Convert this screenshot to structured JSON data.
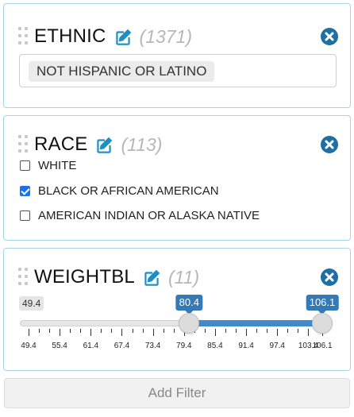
{
  "filters": [
    {
      "title": "ETHNIC",
      "count": "(1371)",
      "selected_values": [
        "NOT HISPANIC OR LATINO"
      ]
    },
    {
      "title": "RACE",
      "count": "(113)",
      "options": [
        {
          "label": "WHITE",
          "checked": false
        },
        {
          "label": "BLACK OR AFRICAN AMERICAN",
          "checked": true
        },
        {
          "label": "AMERICAN INDIAN OR ALASKA NATIVE",
          "checked": false
        }
      ]
    },
    {
      "title": "WEIGHTBL",
      "count": "(11)",
      "slider": {
        "min_label": "49.4",
        "from_label": "80.4",
        "to_label": "106.1",
        "min": 49.4,
        "max": 106.1,
        "from": 80.4,
        "to": 106.1,
        "tick_labels": [
          "49.4",
          "55.4",
          "61.4",
          "67.4",
          "73.4",
          "79.4",
          "85.4",
          "91.4",
          "97.4",
          "103.4",
          "106.1"
        ]
      }
    }
  ],
  "add_filter_label": "Add Filter",
  "colors": {
    "accent": "#1a8fc4",
    "close": "#1f6fa5",
    "range": "#428bca",
    "panel_border": "#a8d4e8"
  },
  "icons": {
    "edit": "edit-icon",
    "close": "close-circle-icon",
    "drag": "drag-handle-icon"
  }
}
